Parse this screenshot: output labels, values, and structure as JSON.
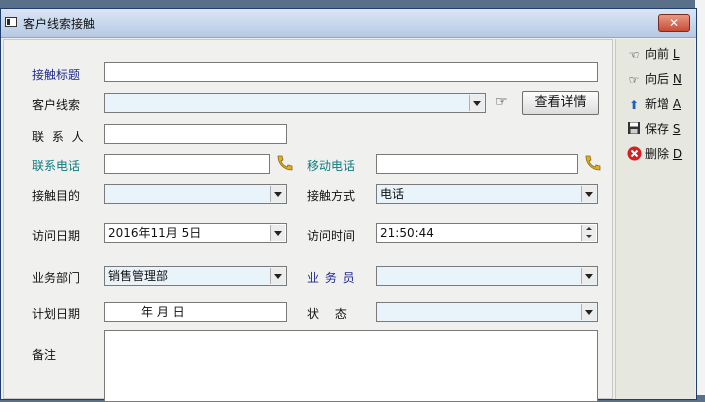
{
  "window": {
    "title": "客户线索接触",
    "close_symbol": "✕"
  },
  "labels": {
    "subject": "接触标题",
    "lead": "客户线索",
    "contact": "联 系 人",
    "phone": "联系电话",
    "mobile": "移动电话",
    "purpose": "接触目的",
    "method": "接触方式",
    "visit_date": "访问日期",
    "visit_time": "访问时间",
    "department": "业务部门",
    "salesperson": "业 务 员",
    "plan_date": "计划日期",
    "status": "状　 态",
    "remark": "备注"
  },
  "values": {
    "subject": "",
    "lead": "",
    "contact": "",
    "phone": "",
    "mobile": "",
    "purpose": "",
    "method": "电话",
    "visit_date": "2016年11月  5日",
    "visit_time": "21:50:44",
    "department": "销售管理部",
    "salesperson": "",
    "plan_date": "年      月      日",
    "status": "",
    "remark": ""
  },
  "buttons": {
    "details": "查看详情"
  },
  "sidebar": {
    "items": [
      {
        "label": "向前",
        "key": "L",
        "icon": "☜"
      },
      {
        "label": "向后",
        "key": "N",
        "icon": "☞"
      },
      {
        "label": "新增",
        "key": "A",
        "icon": "⬆"
      },
      {
        "label": "保存",
        "key": "S",
        "icon": "💾"
      },
      {
        "label": "删除",
        "key": "D",
        "icon": "✖"
      }
    ]
  },
  "colors": {
    "label_blue": "#1f2a8a",
    "label_teal": "#0f7a7e",
    "delete_red": "#d42020"
  }
}
